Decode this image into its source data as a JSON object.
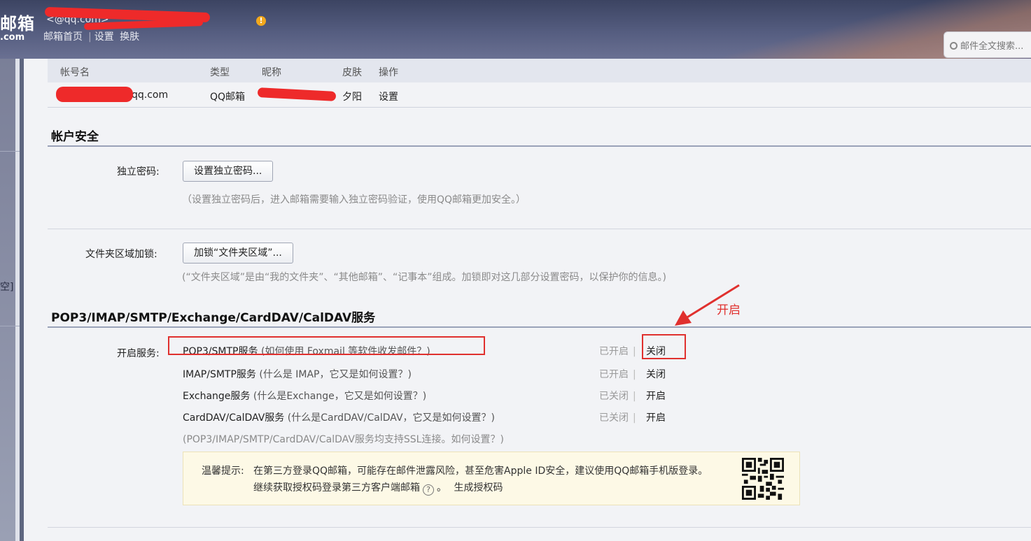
{
  "header": {
    "logo_text": "邮箱",
    "logo_sub": ".com",
    "account_line": "<@qq.com>",
    "nav": {
      "home": "邮箱首页",
      "sep": "|",
      "settings": "设置",
      "switch": "换肤"
    },
    "search_placeholder": "邮件全文搜索..."
  },
  "sidebar": {
    "fragment": "空]"
  },
  "accounts": {
    "headers": {
      "account": "帐号名",
      "type": "类型",
      "nickname": "昵称",
      "skin": "皮肤",
      "action": "操作"
    },
    "row": {
      "account": "@qq.com",
      "type": "QQ邮箱",
      "skin": "夕阳",
      "action": "设置"
    }
  },
  "security": {
    "title": "帐户安全",
    "password": {
      "label": "独立密码:",
      "button": "设置独立密码...",
      "hint": "（设置独立密码后，进入邮箱需要输入独立密码验证，使用QQ邮箱更加安全。）"
    },
    "folder_lock": {
      "label": "文件夹区域加锁:",
      "button": "加锁“文件夹区域”...",
      "hint": "(“文件夹区域”是由“我的文件夹”、“其他邮箱”、“记事本”组成。加锁即对这几部分设置密码，以保护你的信息。)"
    }
  },
  "services": {
    "title": "POP3/IMAP/SMTP/Exchange/CardDAV/CalDAV服务",
    "label": "开启服务:",
    "items": [
      {
        "name": "POP3/SMTP服务",
        "question": "(如何使用 Foxmail 等软件收发邮件？)",
        "status": "已开启",
        "action": "关闭"
      },
      {
        "name": "IMAP/SMTP服务",
        "question": "(什么是 IMAP，它又是如何设置？)",
        "status": "已开启",
        "action": "关闭"
      },
      {
        "name": "Exchange服务",
        "question": "(什么是Exchange，它又是如何设置？)",
        "status": "已关闭",
        "action": "开启"
      },
      {
        "name": "CardDAV/CalDAV服务",
        "question": "(什么是CardDAV/CalDAV，它又是如何设置？)",
        "status": "已关闭",
        "action": "开启"
      }
    ],
    "ssl_note": "(POP3/IMAP/SMTP/CardDAV/CalDAV服务均支持SSL连接。如何设置？)",
    "divider": "|",
    "tip": {
      "label": "温馨提示:",
      "line1": "在第三方登录QQ邮箱，可能存在邮件泄露风险，甚至危害Apple ID安全，建议使用QQ邮箱手机版登录。",
      "line2_text": "继续获取授权码登录第三方客户端邮箱",
      "help_glyph": "?",
      "line2_end": "。",
      "generate": "生成授权码"
    }
  },
  "annotation": {
    "text": "开启",
    "color": "#e0302e"
  }
}
